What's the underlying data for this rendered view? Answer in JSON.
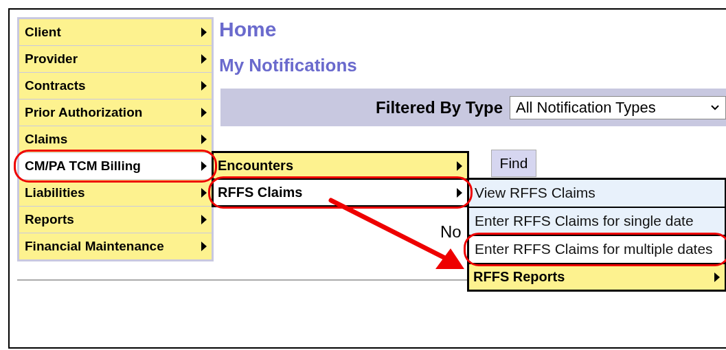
{
  "page": {
    "title": "Home",
    "section": "My Notifications"
  },
  "sidebar": {
    "items": [
      {
        "label": "Client",
        "kind": "submenu",
        "selected": false,
        "circled": false
      },
      {
        "label": "Provider",
        "kind": "submenu",
        "selected": false,
        "circled": false
      },
      {
        "label": "Contracts",
        "kind": "submenu",
        "selected": false,
        "circled": false
      },
      {
        "label": "Prior Authorization",
        "kind": "submenu",
        "selected": false,
        "circled": false
      },
      {
        "label": "Claims",
        "kind": "submenu",
        "selected": false,
        "circled": false
      },
      {
        "label": "CM/PA TCM Billing",
        "kind": "submenu",
        "selected": true,
        "circled": true,
        "children": [
          {
            "label": "Encounters",
            "kind": "submenu",
            "selected": false,
            "circled": false
          },
          {
            "label": "RFFS Claims",
            "kind": "submenu",
            "selected": true,
            "circled": true,
            "children": [
              {
                "label": "View RFFS Claims",
                "kind": "link",
                "selected": false,
                "circled": false
              },
              {
                "label": "Enter RFFS Claims for single date",
                "kind": "link",
                "selected": false,
                "circled": false
              },
              {
                "label": "Enter RFFS Claims for multiple dates",
                "kind": "link",
                "selected": true,
                "circled": true
              },
              {
                "label": "RFFS Reports",
                "kind": "submenu",
                "selected": false,
                "circled": false
              }
            ]
          }
        ]
      },
      {
        "label": "Liabilities",
        "kind": "submenu",
        "selected": false,
        "circled": false
      },
      {
        "label": "Reports",
        "kind": "submenu",
        "selected": false,
        "circled": false
      },
      {
        "label": "Financial Maintenance",
        "kind": "submenu",
        "selected": false,
        "circled": false
      }
    ]
  },
  "filter": {
    "label": "Filtered By Type",
    "value": "All Notification Types"
  },
  "find_button": "Find",
  "message": "No"
}
